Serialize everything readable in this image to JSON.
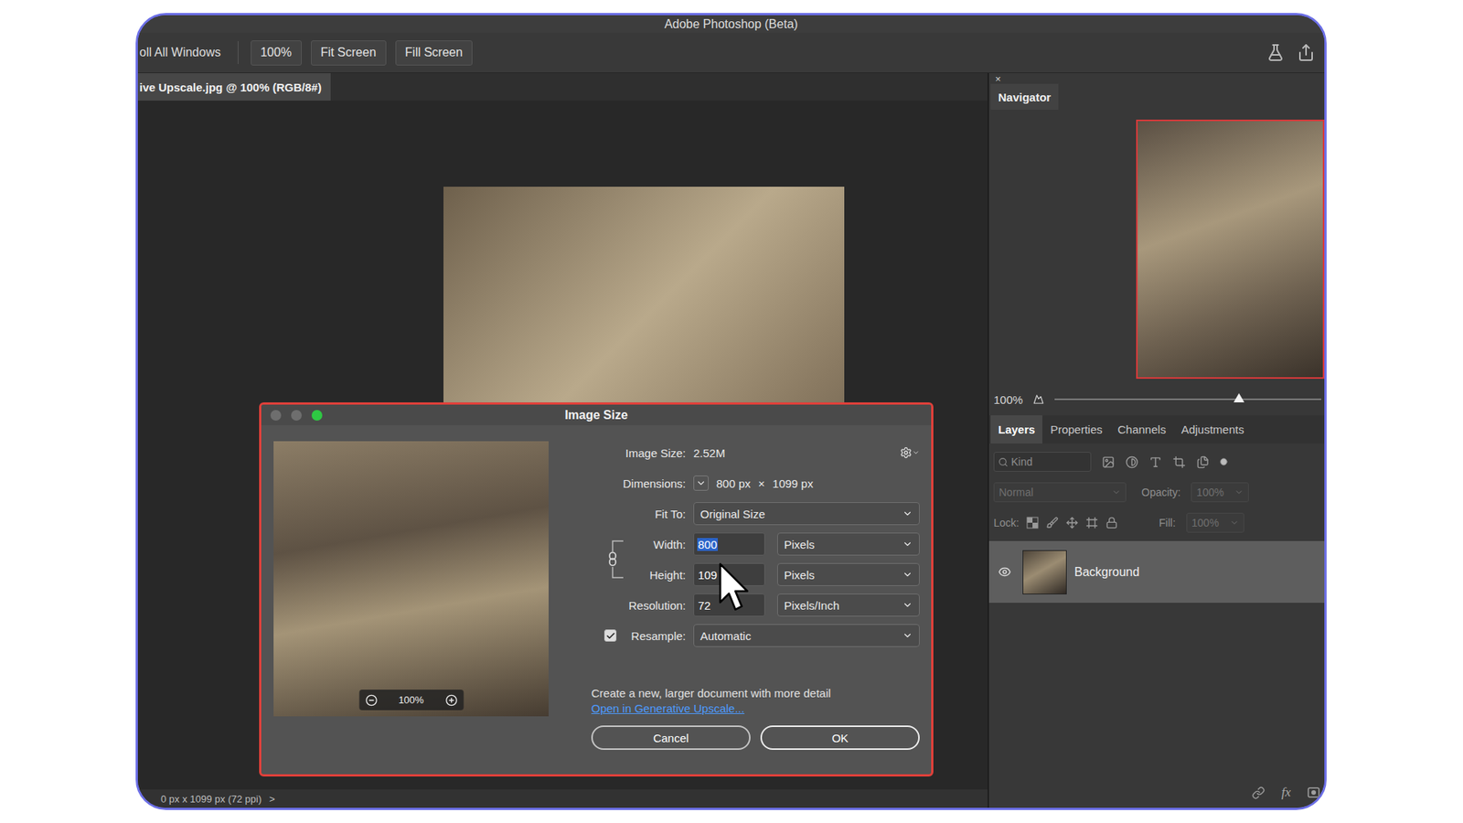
{
  "window": {
    "title": "Adobe Photoshop (Beta)"
  },
  "toolbar": {
    "scroll_all": "oll All Windows",
    "buttons": [
      {
        "label": "100%"
      },
      {
        "label": "Fit Screen"
      },
      {
        "label": "Fill Screen"
      }
    ]
  },
  "document_tab": {
    "label": "ive Upscale.jpg @ 100% (RGB/8#)",
    "selected": true
  },
  "status_bar": {
    "text": "0 px x 1099 px (72 ppi)",
    "arrow": ">"
  },
  "dialog": {
    "title": "Image Size",
    "traffic_lights": [
      {
        "color": "#6e6e6e"
      },
      {
        "color": "#6e6e6e"
      },
      {
        "color": "#2ec843"
      }
    ],
    "preview_zoom": "100%",
    "constrain_proportions": true,
    "fields": [
      {
        "kind": "info",
        "label": "Image Size:",
        "value": "2.52M"
      },
      {
        "kind": "dimensions",
        "label": "Dimensions:",
        "width": "800 px",
        "times": "×",
        "height": "1099 px"
      },
      {
        "kind": "select",
        "label": "Fit To:",
        "value": "Original Size"
      },
      {
        "kind": "linked",
        "label": "Width:",
        "value": "800",
        "unit": "Pixels",
        "selected": true
      },
      {
        "kind": "linked",
        "label": "Height:",
        "value": "109",
        "unit": "Pixels",
        "selected": false
      },
      {
        "kind": "input",
        "label": "Resolution:",
        "value": "72",
        "unit": "Pixels/Inch",
        "selected": false
      },
      {
        "kind": "check",
        "label": "Resample:",
        "checked": true,
        "value": "Automatic"
      }
    ],
    "upscale_note": "Create a new, larger document with more detail",
    "upscale_link": "Open in Generative Upscale...",
    "buttons": [
      {
        "label": "Cancel",
        "default": false
      },
      {
        "label": "OK",
        "default": true
      }
    ]
  },
  "navigator": {
    "close": "×",
    "tab": "Navigator",
    "zoom": "100%",
    "level": 0.69
  },
  "panel_tabs": [
    {
      "label": "Layers",
      "selected": true
    },
    {
      "label": "Properties",
      "selected": false
    },
    {
      "label": "Channels",
      "selected": false
    },
    {
      "label": "Adjustments",
      "selected": false
    }
  ],
  "layers_panel": {
    "filter_placeholder": "Kind",
    "blend_mode": {
      "value": "Normal",
      "disabled": true
    },
    "opacity": {
      "label": "Opacity:",
      "value": "100%",
      "disabled": true
    },
    "lock": {
      "label": "Lock:"
    },
    "fill": {
      "label": "Fill:",
      "value": "100%",
      "disabled": true
    },
    "layers": [
      {
        "name": "Background",
        "visible": true,
        "selected": true
      }
    ],
    "footer_fx": "fx"
  }
}
